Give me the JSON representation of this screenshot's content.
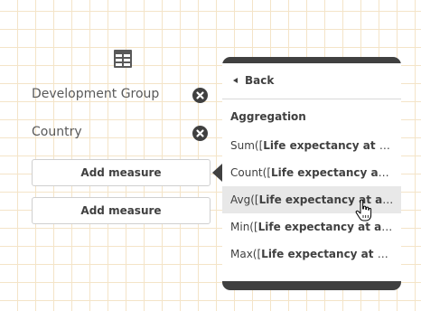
{
  "fields": {
    "dimensions": [
      {
        "label": "Development Group"
      },
      {
        "label": "Country"
      }
    ],
    "measures": [
      {
        "label": "Add measure"
      },
      {
        "label": "Add measure"
      }
    ]
  },
  "popover": {
    "back_label": "Back",
    "section_header": "Aggregation",
    "items": [
      {
        "func": "Sum([",
        "arg": "Life expectancy at age ..."
      },
      {
        "func": "Count([",
        "arg": "Life expectancy at a..."
      },
      {
        "func": "Avg([",
        "arg": "Life expectancy at age ..."
      },
      {
        "func": "Min([",
        "arg": "Life expectancy at age ..."
      },
      {
        "func": "Max([",
        "arg": "Life expectancy at age ..."
      }
    ]
  },
  "icons": {
    "table": "table-icon",
    "remove": "remove-icon",
    "back": "back-triangle-icon",
    "cursor": "hand-pointer-icon"
  },
  "colors": {
    "popover_frame": "#404040",
    "grid_lines": "#f4e4c8",
    "text": "#595959",
    "hover_row": "#e8e8e8"
  }
}
